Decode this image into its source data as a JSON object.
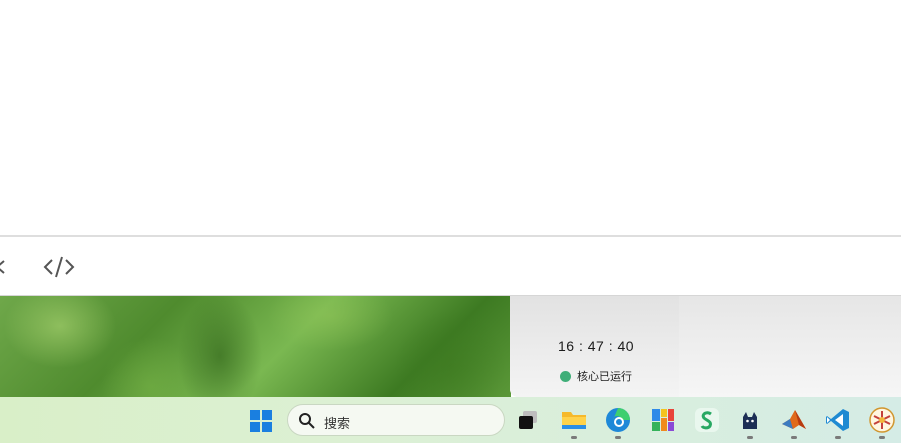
{
  "toolbar": {
    "icons": [
      "partial-chevron-icon",
      "code-icon"
    ]
  },
  "widget": {
    "time": "16 : 47 : 40",
    "status_text": "核心已运行",
    "status_color": "#3fae78"
  },
  "taskbar": {
    "search_placeholder": "搜索",
    "apps": [
      "task-view-icon",
      "file-explorer-icon",
      "edge-icon",
      "colorful-app-icon",
      "green-s-app-icon",
      "cat-app-icon",
      "matlab-icon",
      "vscode-icon",
      "round-app-icon"
    ]
  }
}
